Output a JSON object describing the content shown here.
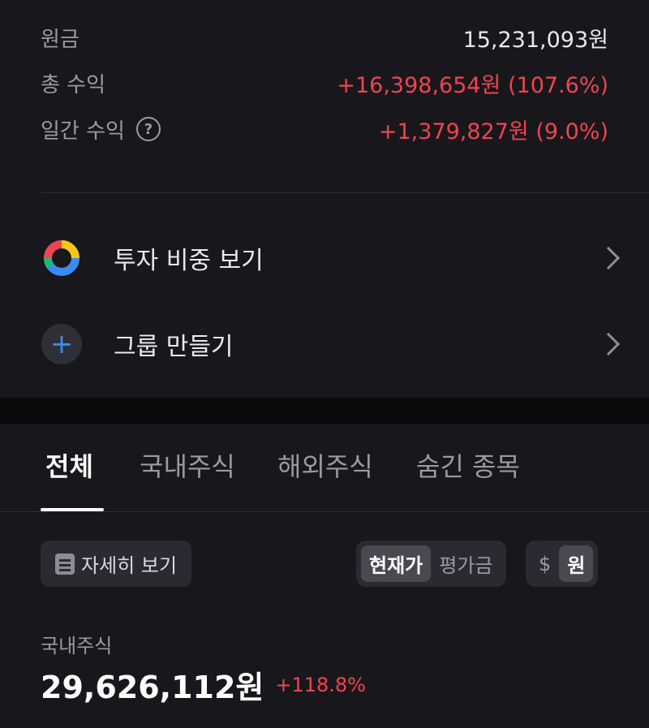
{
  "summary": {
    "principal_label": "원금",
    "principal_value": "15,231,093원",
    "total_profit_label": "총 수익",
    "total_profit_value": "+16,398,654원 (107.6%)",
    "daily_profit_label": "일간 수익",
    "daily_profit_value": "+1,379,827원 (9.0%)",
    "help_glyph": "?"
  },
  "menu": {
    "weight_label": "투자 비중 보기",
    "group_label": "그룹 만들기",
    "plus_glyph": "+"
  },
  "tabs": [
    {
      "label": "전체"
    },
    {
      "label": "국내주식"
    },
    {
      "label": "해외주식"
    },
    {
      "label": "숨긴 종목"
    }
  ],
  "controls": {
    "detail_label": "자세히 보기",
    "price_mode": [
      "현재가",
      "평가금"
    ],
    "currency": [
      "$",
      "원"
    ]
  },
  "asset": {
    "label": "국내주식",
    "value": "29,626,112원",
    "change": "+118.8%"
  },
  "colors": {
    "accent_red": "#f04452",
    "accent_blue": "#3b8bf6",
    "background": "#17171c"
  },
  "icons": {
    "help": "question-circle-icon",
    "donut": "donut-chart-icon",
    "plus": "plus-circle-icon",
    "chevron": "chevron-right-icon",
    "list": "list-icon"
  }
}
